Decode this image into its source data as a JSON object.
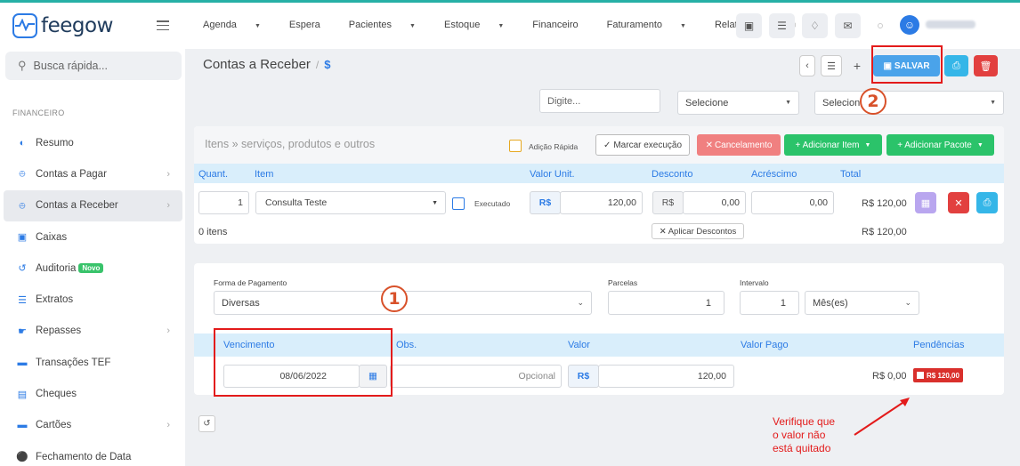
{
  "brand": {
    "name": "feegow",
    "accent": "#26b0a6",
    "primary": "#2c7be5"
  },
  "search": {
    "placeholder": "Busca rápida..."
  },
  "sidebar": {
    "section": "FINANCEIRO",
    "items": [
      {
        "label": "Resumo",
        "icon": "chart-icon",
        "chevron": false
      },
      {
        "label": "Contas a Pagar",
        "icon": "arrow-up-circle-icon",
        "chevron": true
      },
      {
        "label": "Contas a Receber",
        "icon": "arrow-down-circle-icon",
        "chevron": true,
        "active": true
      },
      {
        "label": "Caixas",
        "icon": "inbox-icon",
        "chevron": false
      },
      {
        "label": "Auditoria",
        "icon": "history-icon",
        "chevron": false,
        "badge": "Novo"
      },
      {
        "label": "Extratos",
        "icon": "list-icon",
        "chevron": false
      },
      {
        "label": "Repasses",
        "icon": "handshake-icon",
        "chevron": true
      },
      {
        "label": "Transações TEF",
        "icon": "card-icon",
        "chevron": false
      },
      {
        "label": "Cheques",
        "icon": "cheque-icon",
        "chevron": false
      },
      {
        "label": "Cartões",
        "icon": "card-icon",
        "chevron": true
      },
      {
        "label": "Fechamento de Data",
        "icon": "lock-icon",
        "chevron": false
      }
    ]
  },
  "topmenu": {
    "items": [
      {
        "label": "Agenda",
        "caret": true
      },
      {
        "label": "Espera",
        "caret": false
      },
      {
        "label": "Pacientes",
        "caret": true
      },
      {
        "label": "Estoque",
        "caret": true
      },
      {
        "label": "Financeiro",
        "caret": false
      },
      {
        "label": "Faturamento",
        "caret": true
      },
      {
        "label": "Relatórios",
        "caret": false
      }
    ]
  },
  "header": {
    "title": "Contas a Receber",
    "currency_symbol": "$",
    "save_label": "SALVAR"
  },
  "form_top": {
    "voucher_placeholder": "Digite...",
    "profissional_value": "Selecione",
    "tabela_value": "Selecione"
  },
  "items": {
    "placeholder": "Itens » serviços, produtos e outros",
    "adicao_rapida": "Adição Rápida",
    "marcar_execucao": "Marcar execução",
    "cancelamento": "Cancelamento",
    "adicionar_item": "+ Adicionar Item",
    "adicionar_pacote": "+ Adicionar Pacote",
    "columns": [
      "Quant.",
      "Item",
      "Valor Unit.",
      "Desconto",
      "Acréscimo",
      "Total"
    ],
    "row": {
      "quant": "1",
      "item": "Consulta Teste",
      "executado": "Executado",
      "currency": "R$",
      "valor_unit": "120,00",
      "desconto": "0,00",
      "acrescimo": "0,00",
      "total": "R$ 120,00"
    },
    "count": "0 itens",
    "aplicar_descontos": "Aplicar Descontos",
    "grand_total": "R$ 120,00"
  },
  "payment": {
    "forma_label": "Forma de Pagamento",
    "forma_value": "Diversas",
    "parcelas_label": "Parcelas",
    "parcelas_value": "1",
    "intervalo_label": "Intervalo",
    "intervalo_value": "1",
    "intervalo_unit": "Mês(es)",
    "columns": [
      "Vencimento",
      "Obs.",
      "Valor",
      "Valor Pago",
      "Pendências"
    ],
    "row": {
      "vencimento": "08/06/2022",
      "obs_placeholder": "Opcional",
      "currency": "R$",
      "valor": "120,00",
      "valor_pago": "R$ 0,00",
      "pendencia": "R$ 120,00"
    }
  },
  "annotations": {
    "step1": "1",
    "step2": "2",
    "note": [
      "Verifique que",
      "o valor não",
      "está quitado"
    ],
    "color": "#e31b1b"
  }
}
